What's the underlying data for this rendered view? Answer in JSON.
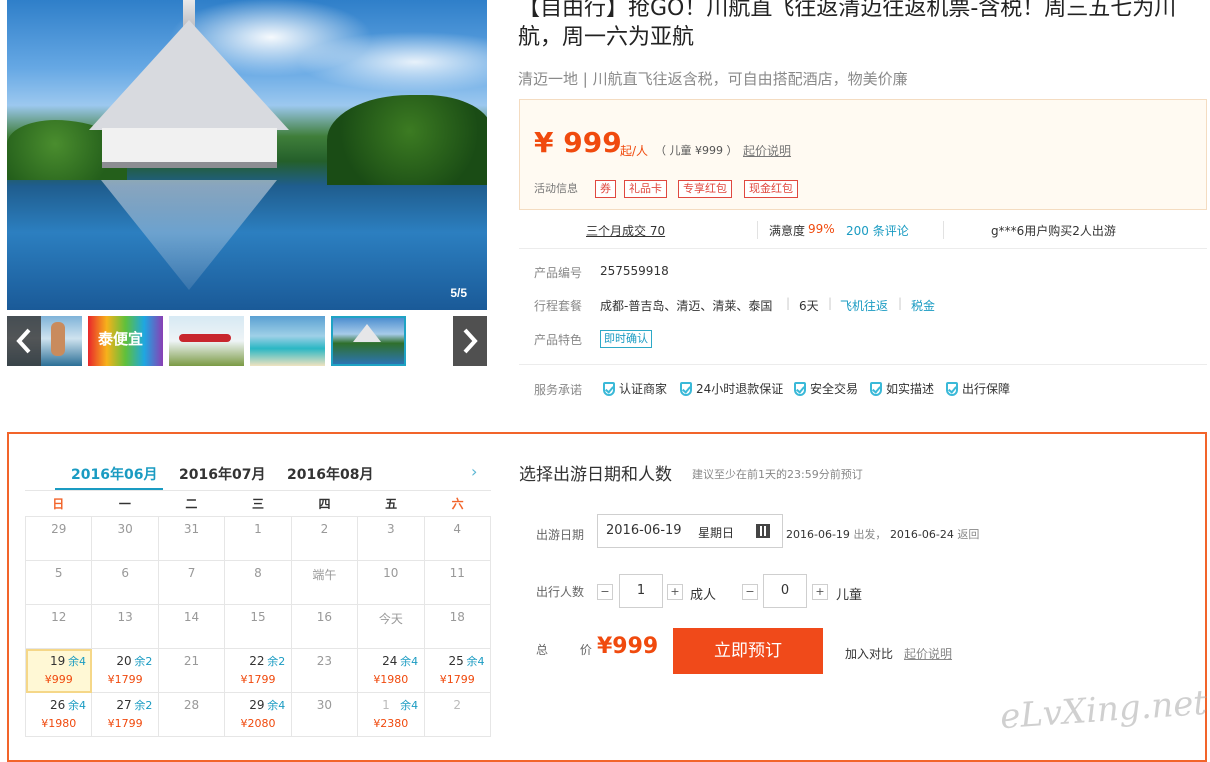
{
  "product": {
    "title": "【自由行】抢GO！川航直飞往返清迈往返机票-含税！周三五七为川航，周一六为亚航",
    "subtitle": "清迈一地 | 川航直飞往返含税，可自由搭配酒店，物美价廉"
  },
  "gallery": {
    "counter": "5/5",
    "thumbs": [
      "beach-surfer",
      "promo-cheap",
      "airplane",
      "island-beach",
      "temple-lake"
    ],
    "thumb2_text": "泰便宜",
    "selected_index": 4
  },
  "price": {
    "amount": "¥ 999",
    "unit": "起/人",
    "child": "（ 儿童 ¥999 ）",
    "explain": "起价说明",
    "promo_label": "活动信息",
    "tags": [
      "券",
      "礼品卡",
      "专享红包",
      "现金红包"
    ]
  },
  "stats": {
    "sold": "三个月成交 70",
    "satisfaction_label": "满意度",
    "satisfaction": "99%",
    "reviews": "200 条评论",
    "recent": "g***6用户购买2人出游"
  },
  "info": {
    "code_label": "产品编号",
    "code": "257559918",
    "package_label": "行程套餐",
    "route": "成都-普吉岛、清迈、清莱、泰国",
    "days": "6天",
    "flight": "飞机往返",
    "tax": "税金",
    "feature_label": "产品特色",
    "feature": "即时确认",
    "service_label": "服务承诺",
    "services": [
      "认证商家",
      "24小时退款保证",
      "安全交易",
      "如实描述",
      "出行保障"
    ]
  },
  "calendar": {
    "months": [
      "2016年06月",
      "2016年07月",
      "2016年08月"
    ],
    "weekdays": [
      "日",
      "一",
      "二",
      "三",
      "四",
      "五",
      "六"
    ],
    "rows": [
      [
        {
          "d": "29"
        },
        {
          "d": "30"
        },
        {
          "d": "31"
        },
        {
          "d": "1"
        },
        {
          "d": "2"
        },
        {
          "d": "3"
        },
        {
          "d": "4"
        }
      ],
      [
        {
          "d": "5"
        },
        {
          "d": "6"
        },
        {
          "d": "7"
        },
        {
          "d": "8"
        },
        {
          "d": "端午"
        },
        {
          "d": "10"
        },
        {
          "d": "11"
        }
      ],
      [
        {
          "d": "12"
        },
        {
          "d": "13"
        },
        {
          "d": "14"
        },
        {
          "d": "15"
        },
        {
          "d": "16"
        },
        {
          "d": "今天"
        },
        {
          "d": "18"
        }
      ],
      [
        {
          "d": "19",
          "r": "余4",
          "p": "¥999",
          "sel": true
        },
        {
          "d": "20",
          "r": "余2",
          "p": "¥1799"
        },
        {
          "d": "21"
        },
        {
          "d": "22",
          "r": "余2",
          "p": "¥1799"
        },
        {
          "d": "23"
        },
        {
          "d": "24",
          "r": "余4",
          "p": "¥1980"
        },
        {
          "d": "25",
          "r": "余4",
          "p": "¥1799"
        }
      ],
      [
        {
          "d": "26",
          "r": "余4",
          "p": "¥1980"
        },
        {
          "d": "27",
          "r": "余2",
          "p": "¥1799"
        },
        {
          "d": "28"
        },
        {
          "d": "29",
          "r": "余4",
          "p": "¥2080"
        },
        {
          "d": "30"
        },
        {
          "d": "1",
          "r": "余4",
          "p": "¥2380",
          "faded": true
        },
        {
          "d": "2",
          "faded": true
        }
      ]
    ]
  },
  "booking": {
    "title": "选择出游日期和人数",
    "hint": "建议至少在前1天的23:59分前预订",
    "date_label": "出游日期",
    "date": "2016-06-19",
    "weekday": "星期日",
    "depart": "2016-06-19",
    "depart_word": "出发，",
    "return": "2016-06-24",
    "return_word": "返回",
    "people_label": "出行人数",
    "adults": "1",
    "adult_label": "成人",
    "children": "0",
    "child_label": "儿童",
    "minus": "−",
    "plus": "+",
    "total_label": "总 价",
    "total": "¥999",
    "book_button": "立即预订",
    "compare": "加入对比",
    "explain": "起价说明"
  },
  "watermark": "eLvXing.net",
  "colors": {
    "accent": "#f04a0e",
    "link": "#1a9bc2",
    "border": "#f2642a"
  }
}
